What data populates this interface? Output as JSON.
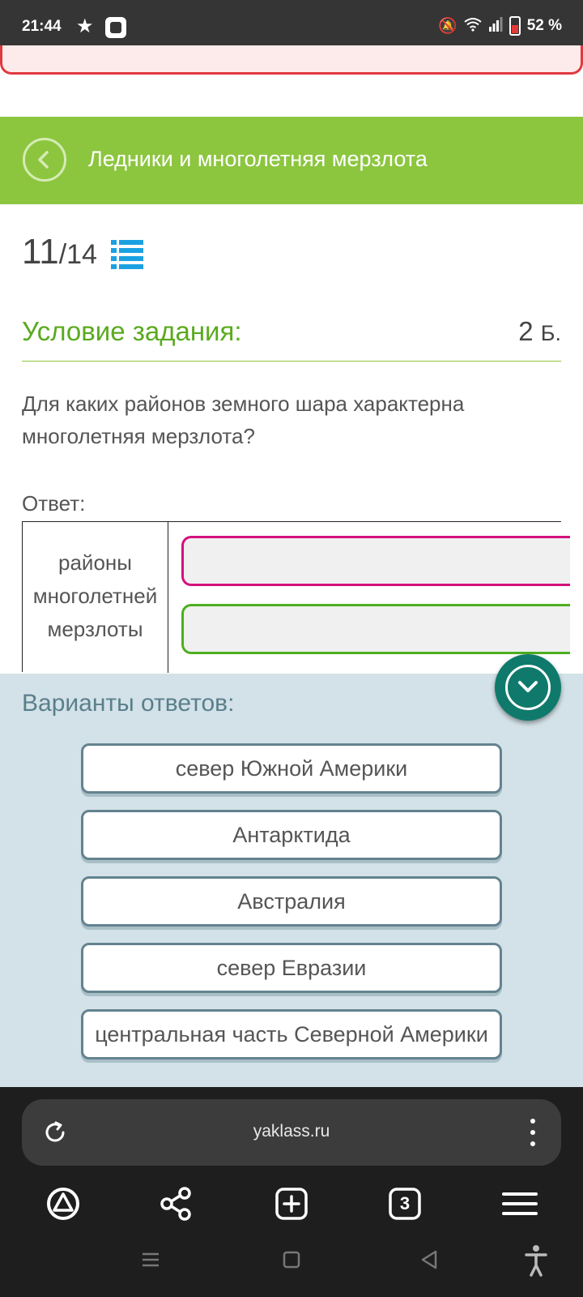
{
  "status_bar": {
    "time": "21:44",
    "battery": "52 %"
  },
  "header": {
    "title": "Ледники и многолетняя мерзлота"
  },
  "progress": {
    "current": "11",
    "total": "/14"
  },
  "task": {
    "condition_label": "Условие задания:",
    "points_value": "2",
    "points_unit": "Б.",
    "question": "Для каких районов земного шара характерна многолетняя мерзлота?",
    "answer_label": "Ответ:",
    "category": "районы многолетней мерзлоты"
  },
  "variants": {
    "title": "Варианты ответов:",
    "options": [
      "север Южной Америки",
      "Антарктида",
      "Австралия",
      "север Евразии",
      "центральная часть Северной Америки"
    ]
  },
  "browser": {
    "url": "yaklass.ru",
    "tab_count": "3"
  },
  "colors": {
    "header_green": "#8cc63f",
    "condition_green": "#5aaa1e",
    "slot_pink": "#d4107c",
    "slot_green": "#4caf1e",
    "variants_bg": "#d3e2e8",
    "fab_teal": "#0f7a6c",
    "link_blue": "#1ba1e2"
  }
}
